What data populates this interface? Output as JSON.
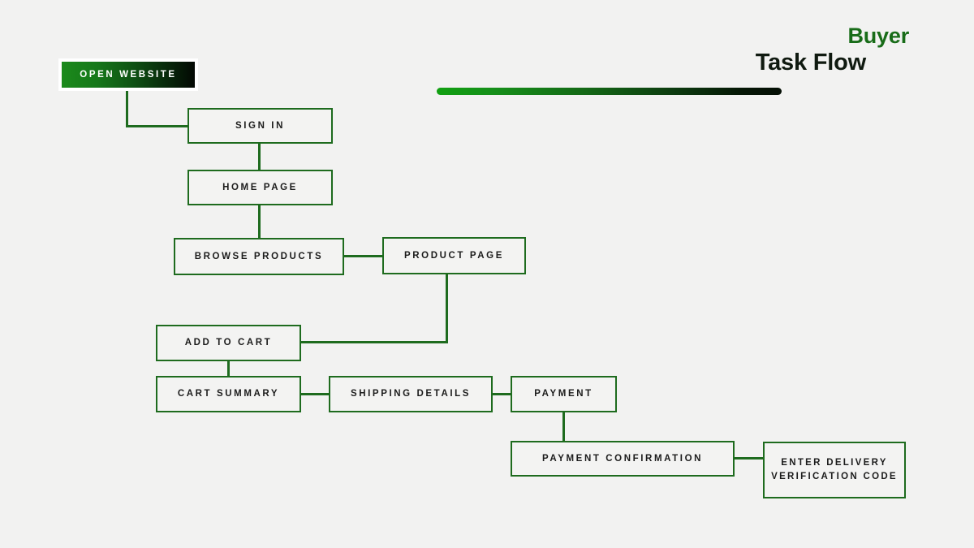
{
  "header": {
    "eyebrow": "Buyer",
    "title": "Task Flow",
    "rule_gradient_from": "#11a011",
    "rule_gradient_to": "#050f05"
  },
  "theme": {
    "background": "#f2f2f1",
    "node_border": "#1e6b1e",
    "node_fill": "#f3f3f2",
    "node_text": "#1c1c1c",
    "accent_green": "#186c18",
    "title_black": "#101a10",
    "start_text": "#ffffff"
  },
  "chart_data": {
    "type": "diagram",
    "title": "Buyer Task Flow",
    "nodes": [
      {
        "id": "open_website",
        "label": "OPEN WEBSITE",
        "style": "gradient"
      },
      {
        "id": "sign_in",
        "label": "SIGN IN",
        "style": "outline"
      },
      {
        "id": "home_page",
        "label": "HOME PAGE",
        "style": "outline"
      },
      {
        "id": "browse_products",
        "label": "BROWSE PRODUCTS",
        "style": "outline"
      },
      {
        "id": "product_page",
        "label": "PRODUCT PAGE",
        "style": "outline"
      },
      {
        "id": "add_to_cart",
        "label": "ADD TO CART",
        "style": "outline"
      },
      {
        "id": "cart_summary",
        "label": "CART SUMMARY",
        "style": "outline"
      },
      {
        "id": "shipping_details",
        "label": "SHIPPING DETAILS",
        "style": "outline"
      },
      {
        "id": "payment",
        "label": "PAYMENT",
        "style": "outline"
      },
      {
        "id": "payment_confirmation",
        "label": "PAYMENT CONFIRMATION",
        "style": "outline"
      },
      {
        "id": "verification_code",
        "label": "ENTER DELIVERY VERIFICATION CODE",
        "style": "outline"
      }
    ],
    "edges": [
      {
        "from": "open_website",
        "to": "sign_in"
      },
      {
        "from": "sign_in",
        "to": "home_page"
      },
      {
        "from": "home_page",
        "to": "browse_products"
      },
      {
        "from": "browse_products",
        "to": "product_page"
      },
      {
        "from": "product_page",
        "to": "add_to_cart"
      },
      {
        "from": "add_to_cart",
        "to": "cart_summary"
      },
      {
        "from": "cart_summary",
        "to": "shipping_details"
      },
      {
        "from": "shipping_details",
        "to": "payment"
      },
      {
        "from": "payment",
        "to": "payment_confirmation"
      },
      {
        "from": "payment_confirmation",
        "to": "verification_code"
      }
    ]
  }
}
